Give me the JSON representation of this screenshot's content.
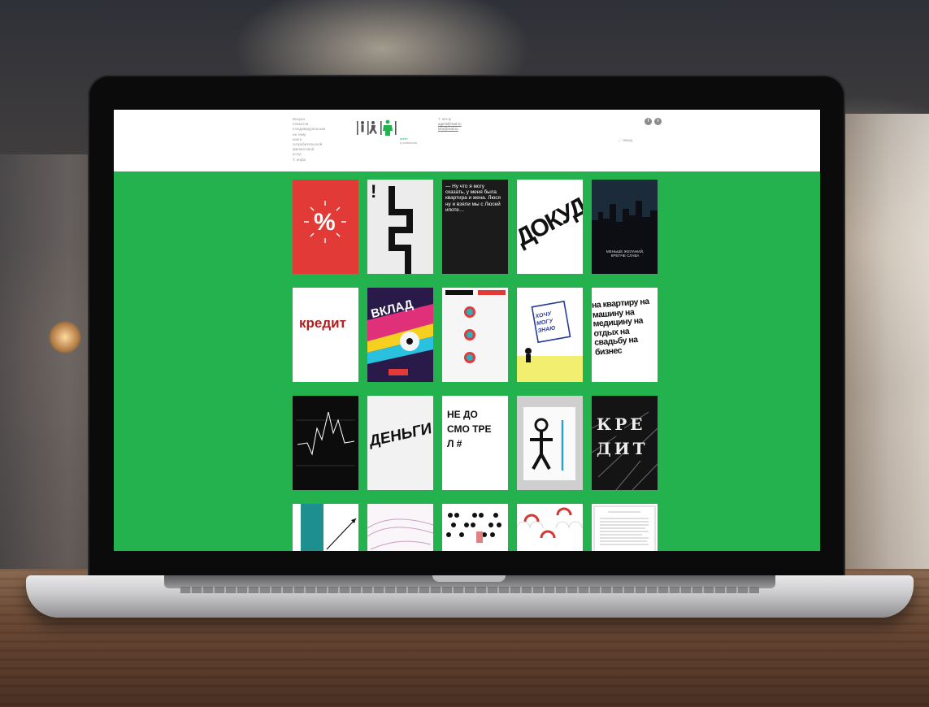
{
  "header": {
    "nav_items": [
      "Визуал",
      "плакатов",
      "к индивидуальным",
      "на тему",
      "книга",
      "потребительской",
      "финансовой",
      "услуг",
      "Т. инфо"
    ],
    "logo_lines": [
      "агент",
      "и компания"
    ],
    "contacts": {
      "label": "Т. автор",
      "links": [
        "agent@mail.ru",
        "info@mail.ru"
      ]
    },
    "social": [
      "f",
      "t"
    ],
    "lang_label": "← Назад"
  },
  "posters": [
    {
      "text": "%",
      "bg": "#e23a36",
      "color": "#ffffff"
    },
    {
      "text": "!",
      "bg": "#ececec",
      "color": "#111111"
    },
    {
      "text": "— Ну что я могу сказать, у меня была квартира и жена. Люся ну и взяли мы с Люсей ипоте…",
      "bg": "#1b1b1b",
      "color": "#ffffff"
    },
    {
      "text": "ДОКУД",
      "bg": "#ffffff",
      "color": "#111111"
    },
    {
      "text": "МЕНЬШЕ ЖЕЛАНИЙ, КРЕПЧЕ СЛАВА",
      "bg": "#1c2b3a",
      "color": "#dddddd"
    },
    {
      "text": "кредит",
      "bg": "#ffffff",
      "color": "#b01e1e"
    },
    {
      "text": "ВКЛАД",
      "bg": "#2a1a4a",
      "color": "#ffffff"
    },
    {
      "text": "",
      "bg": "#f6f6f6",
      "color": "#e23a36"
    },
    {
      "text": "ХОЧУ МОГУ ЗНАЮ",
      "bg": "#ffffff",
      "color": "#2a3a9a"
    },
    {
      "text": "на квартиру на машину на медицину на отдых на свадьбу на бизнес",
      "bg": "#ffffff",
      "color": "#111111"
    },
    {
      "text": "",
      "bg": "#0c0c0c",
      "color": "#ffffff"
    },
    {
      "text": "ДЕНЬГИ",
      "bg": "#f2f2f2",
      "color": "#111111"
    },
    {
      "text": "НЕ ДО СМО ТРЕ Л #",
      "bg": "#ffffff",
      "color": "#111111"
    },
    {
      "text": "",
      "bg": "#cfcfcf",
      "color": "#111111"
    },
    {
      "text": "КРЕ ДИТ",
      "bg": "#141414",
      "color": "#eeeeee"
    },
    {
      "text": "",
      "bg": "#ffffff",
      "color": "#1d8f8f"
    },
    {
      "text": "",
      "bg": "#faf5f8",
      "color": "#c7a0c0"
    },
    {
      "text": "",
      "bg": "#ffffff",
      "color": "#111111"
    },
    {
      "text": "",
      "bg": "#ffffff",
      "color": "#d8352f"
    },
    {
      "text": "",
      "bg": "#ffffff",
      "color": "#777777"
    }
  ]
}
